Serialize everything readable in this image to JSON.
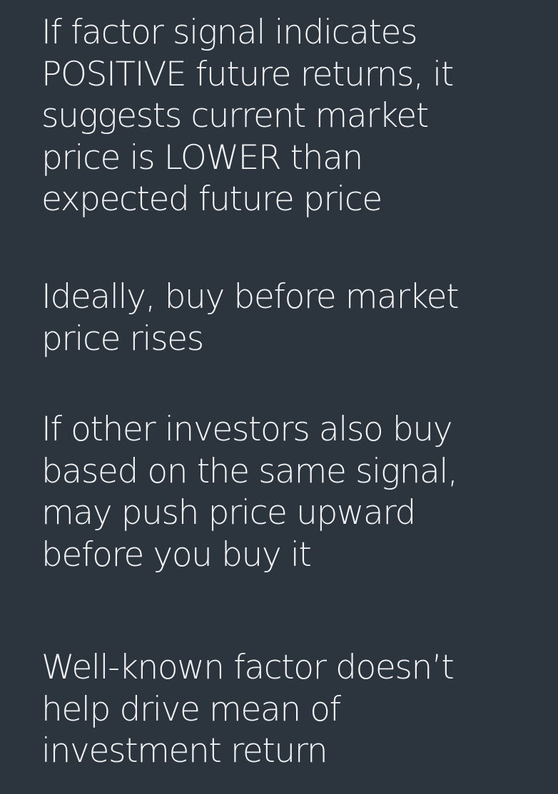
{
  "paragraphs": [
    {
      "lines": [
        "If factor signal indicates",
        "POSITIVE future returns, it",
        "suggests current market",
        "price is LOWER than",
        "expected future price"
      ]
    },
    {
      "lines": [
        "Ideally, buy before market",
        "price rises"
      ]
    },
    {
      "lines": [
        "If other investors also buy",
        "based on the same signal,",
        "may push price upward",
        "before you buy it"
      ]
    },
    {
      "lines": [
        "Well-known factor doesn’t",
        "help drive mean of",
        "investment return"
      ]
    }
  ],
  "colors": {
    "background": "#2c343e",
    "text": "#f2f4f5"
  }
}
